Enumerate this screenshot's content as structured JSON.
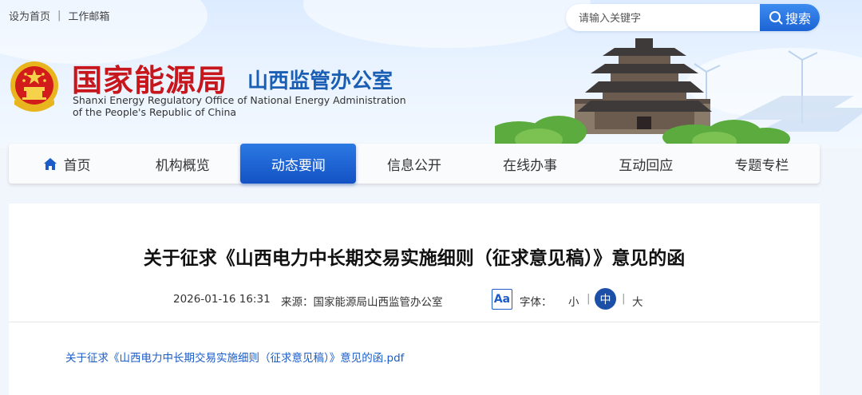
{
  "header": {
    "top_links": [
      "设为首页",
      "工作邮箱"
    ],
    "search_placeholder": "请输入关键字",
    "search_button": "搜索",
    "logo_title": "国家能源局",
    "logo_subtitle": "山西监管办公室",
    "logo_en_line1": "Shanxi Energy Regulatory Office of National Energy Administration",
    "logo_en_line2": "of the People's Republic of China"
  },
  "nav": {
    "items": [
      "首页",
      "机构概览",
      "动态要闻",
      "信息公开",
      "在线办事",
      "互动回应",
      "专题专栏"
    ],
    "active": "动态要闻"
  },
  "article": {
    "title": "关于征求《山西电力中长期交易实施细则（征求意见稿）》意见的函",
    "date": "2026-01-16 16:31",
    "source": "来源：国家能源局山西监管办公室",
    "font_icon": "Aa",
    "font_label": "字体：",
    "font_sizes": [
      "小",
      "中",
      "大"
    ],
    "font_selected": "中",
    "attachment": "关于征求《山西电力中长期交易实施细则（征求意见稿）》意见的函.pdf"
  },
  "colors": {
    "brand_red": "#c8161d",
    "brand_blue": "#1a5fb4",
    "nav_active": "#1f66d6",
    "link": "#1b5cc9"
  }
}
